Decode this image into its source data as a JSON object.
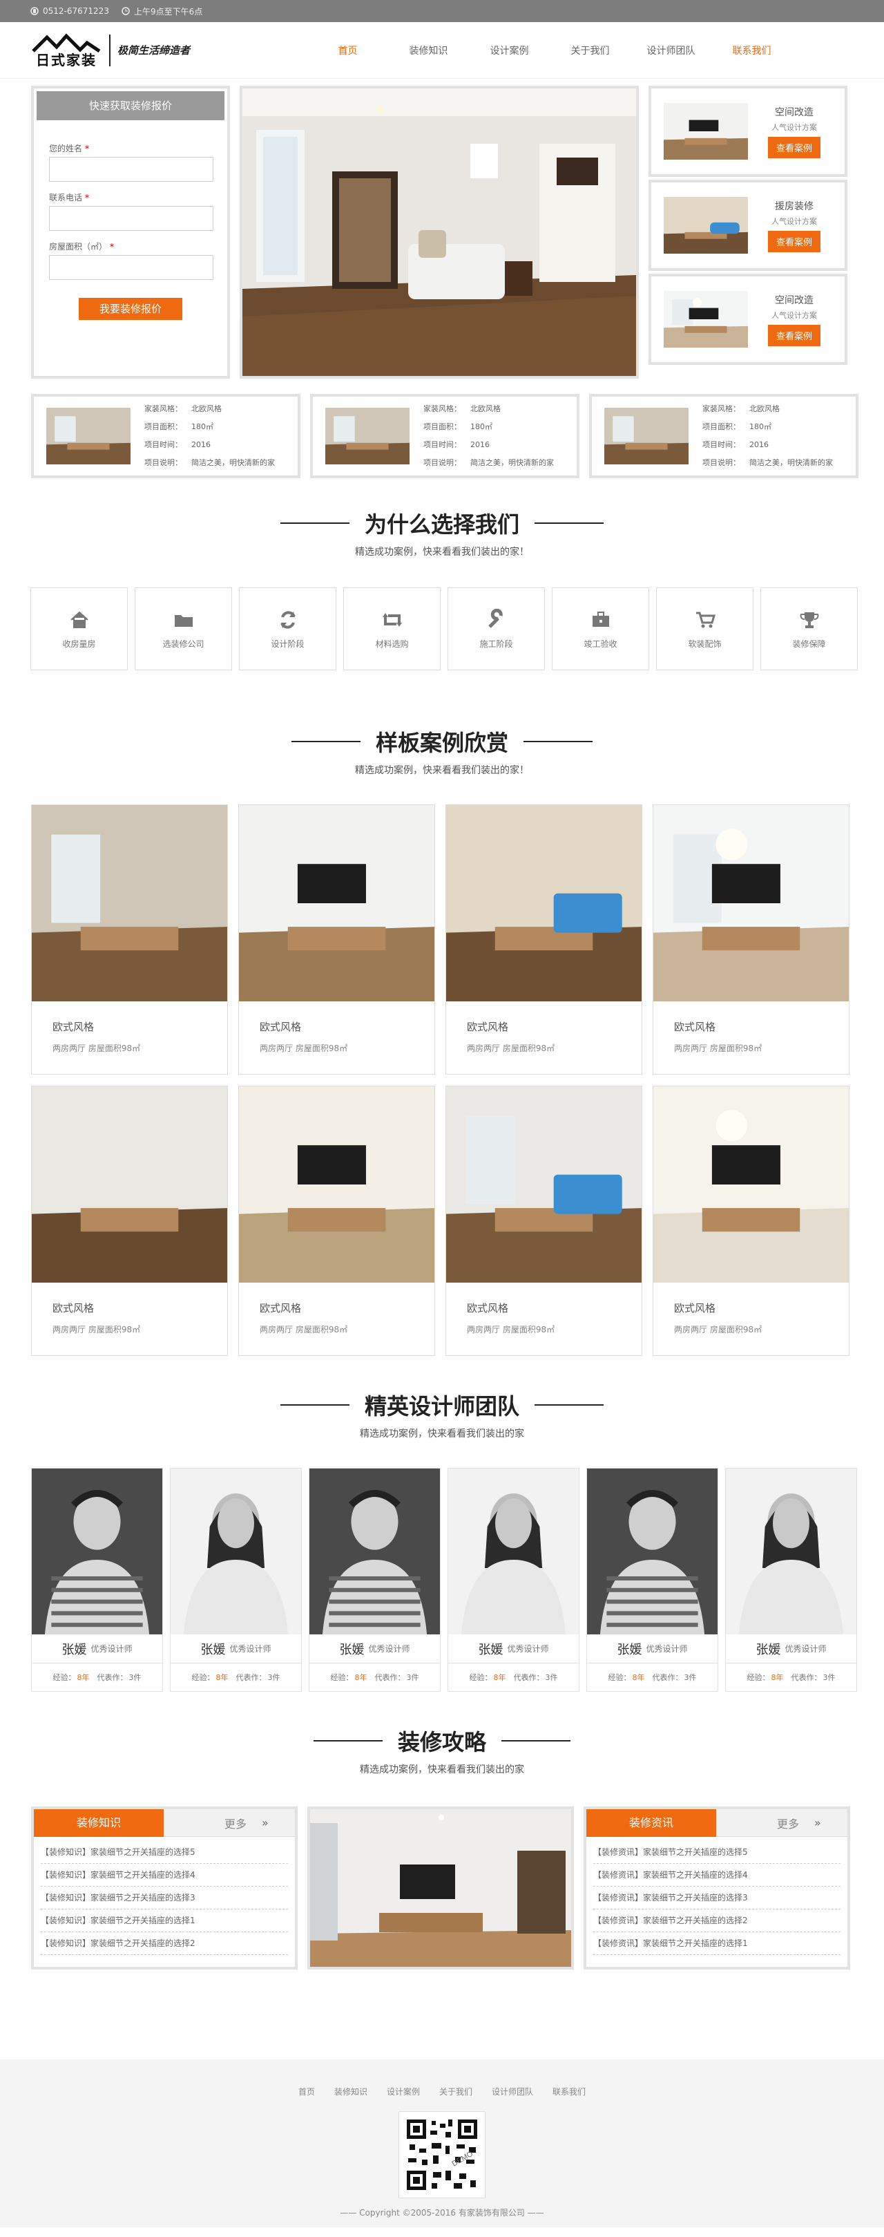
{
  "topbar": {
    "phone": "0512-67671223",
    "hours": "上午9点至下午6点"
  },
  "logo": {
    "name": "日式家装",
    "slogan": "极简生活缔造者"
  },
  "nav": [
    {
      "label": "首页",
      "active": true
    },
    {
      "label": "装修知识"
    },
    {
      "label": "设计案例"
    },
    {
      "label": "关于我们"
    },
    {
      "label": "设计师团队"
    },
    {
      "label": "联系我们",
      "accent": true
    }
  ],
  "quote": {
    "title": "快速获取装修报价",
    "name_label": "您的姓名",
    "phone_label": "联系电话",
    "area_label": "房屋面积（㎡）",
    "required_mark": "*",
    "submit": "我要装修报价"
  },
  "side_cases": [
    {
      "title": "空间改造",
      "sub": "人气设计方案",
      "button": "查看案例"
    },
    {
      "title": "援房装修",
      "sub": "人气设计方案",
      "button": "查看案例"
    },
    {
      "title": "空间改造",
      "sub": "人气设计方案",
      "button": "查看案例"
    }
  ],
  "projects": [
    {
      "style_k": "家装风格：",
      "style_v": "北欧风格",
      "area_k": "项目面积：",
      "area_v": "180㎡",
      "time_k": "项目时间：",
      "time_v": "2016",
      "desc_k": "项目说明：",
      "desc_v": "简洁之美，明快清新的家"
    },
    {
      "style_k": "家装风格：",
      "style_v": "北欧风格",
      "area_k": "项目面积：",
      "area_v": "180㎡",
      "time_k": "项目时间：",
      "time_v": "2016",
      "desc_k": "项目说明：",
      "desc_v": "简洁之美，明快清新的家"
    },
    {
      "style_k": "家装风格：",
      "style_v": "北欧风格",
      "area_k": "项目面积：",
      "area_v": "180㎡",
      "time_k": "项目时间：",
      "time_v": "2016",
      "desc_k": "项目说明：",
      "desc_v": "简洁之美，明快清新的家"
    }
  ],
  "why": {
    "title": "为什么选择我们",
    "sub": "精选成功案例，快来看看我们装出的家！",
    "items": [
      {
        "label": "收房量房",
        "icon": "home-icon"
      },
      {
        "label": "选装修公司",
        "icon": "folder-icon"
      },
      {
        "label": "设计阶段",
        "icon": "refresh-icon"
      },
      {
        "label": "材料选购",
        "icon": "retweet-icon"
      },
      {
        "label": "施工阶段",
        "icon": "wrench-icon"
      },
      {
        "label": "竣工验收",
        "icon": "toolbox-icon"
      },
      {
        "label": "软装配饰",
        "icon": "cart-icon"
      },
      {
        "label": "装修保障",
        "icon": "trophy-icon"
      }
    ]
  },
  "cases": {
    "title": "样板案例欣赏",
    "sub": "精选成功案例，快来看看我们装出的家！",
    "items": [
      {
        "title": "欧式风格",
        "desc": "两房两厅 房屋面积98㎡"
      },
      {
        "title": "欧式风格",
        "desc": "两房两厅 房屋面积98㎡"
      },
      {
        "title": "欧式风格",
        "desc": "两房两厅 房屋面积98㎡"
      },
      {
        "title": "欧式风格",
        "desc": "两房两厅 房屋面积98㎡"
      },
      {
        "title": "欧式风格",
        "desc": "两房两厅 房屋面积98㎡"
      },
      {
        "title": "欧式风格",
        "desc": "两房两厅 房屋面积98㎡"
      },
      {
        "title": "欧式风格",
        "desc": "两房两厅 房屋面积98㎡"
      },
      {
        "title": "欧式风格",
        "desc": "两房两厅 房屋面积98㎡"
      }
    ]
  },
  "team": {
    "title": "精英设计师团队",
    "sub": "精选成功案例，快来看看我们装出的家",
    "members": [
      {
        "name": "张媛",
        "role": "优秀设计师",
        "exp_k": "经验：",
        "exp_v": "8年",
        "works_k": "代表作：",
        "works_v": "3件",
        "gender": "m"
      },
      {
        "name": "张媛",
        "role": "优秀设计师",
        "exp_k": "经验：",
        "exp_v": "8年",
        "works_k": "代表作：",
        "works_v": "3件",
        "gender": "f"
      },
      {
        "name": "张媛",
        "role": "优秀设计师",
        "exp_k": "经验：",
        "exp_v": "8年",
        "works_k": "代表作：",
        "works_v": "3件",
        "gender": "m"
      },
      {
        "name": "张媛",
        "role": "优秀设计师",
        "exp_k": "经验：",
        "exp_v": "8年",
        "works_k": "代表作：",
        "works_v": "3件",
        "gender": "f"
      },
      {
        "name": "张媛",
        "role": "优秀设计师",
        "exp_k": "经验：",
        "exp_v": "8年",
        "works_k": "代表作：",
        "works_v": "3件",
        "gender": "m"
      },
      {
        "name": "张媛",
        "role": "优秀设计师",
        "exp_k": "经验：",
        "exp_v": "8年",
        "works_k": "代表作：",
        "works_v": "3件",
        "gender": "f"
      }
    ]
  },
  "guide": {
    "title": "装修攻略",
    "sub": "精选成功案例，快来看看我们装出的家",
    "left": {
      "tab": "装修知识",
      "more": "更多",
      "items": [
        "【装修知识】家装细节之开关插座的选择5",
        "【装修知识】家装细节之开关插座的选择4",
        "【装修知识】家装细节之开关插座的选择3",
        "【装修知识】家装细节之开关插座的选择1",
        "【装修知识】家装细节之开关插座的选择2"
      ]
    },
    "right": {
      "tab": "装修资讯",
      "more": "更多",
      "items": [
        "【装修资讯】家装细节之开关插座的选择5",
        "【装修资讯】家装细节之开关插座的选择4",
        "【装修资讯】家装细节之开关插座的选择3",
        "【装修资讯】家装细节之开关插座的选择2",
        "【装修资讯】家装细节之开关插座的选择1"
      ]
    }
  },
  "footer": {
    "nav": [
      "首页",
      "装修知识",
      "设计案例",
      "关于我们",
      "设计师团队",
      "联系我们"
    ],
    "qr_label": "DEMO",
    "copyright": "—— Copyright ©2005-2016 有家装饰有限公司 ——"
  },
  "colors": {
    "accent": "#ef6a10",
    "topbar": "#7d7d7d",
    "border": "#e2e2e2"
  }
}
